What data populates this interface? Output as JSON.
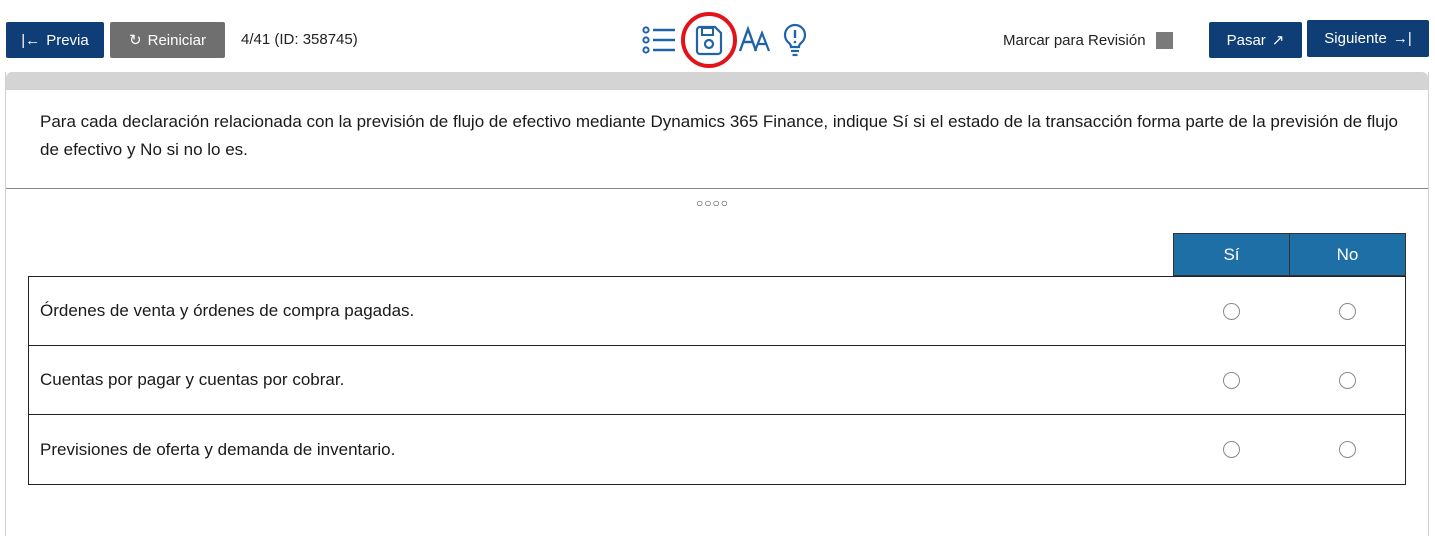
{
  "toolbar": {
    "prev_label": "Previa",
    "restart_label": "Reiniciar",
    "progress": "4/41 (ID: 358745)",
    "review_label": "Marcar para Revisión",
    "skip_label": "Pasar",
    "next_label": "Siguiente",
    "icons": [
      "list-icon",
      "save-icon",
      "font-size-icon",
      "hint-icon"
    ]
  },
  "question": {
    "text": "Para cada declaración relacionada con la previsión de flujo de efectivo mediante Dynamics 365 Finance, indique Sí si el estado de la transacción forma parte de la previsión de flujo de efectivo y No si no lo es.",
    "pager": "○○○○"
  },
  "grid": {
    "columns": [
      "Sí",
      "No"
    ],
    "rows": [
      {
        "label": "Órdenes de venta y órdenes de compra pagadas."
      },
      {
        "label": "Cuentas por pagar y cuentas por cobrar."
      },
      {
        "label": "Previsiones de oferta y demanda de inventario."
      }
    ]
  },
  "colors": {
    "nav_button": "#0f3d75",
    "restart_button": "#6f6f6f",
    "header_cell": "#1e6fa6",
    "highlight_circle": "#e0141a"
  }
}
